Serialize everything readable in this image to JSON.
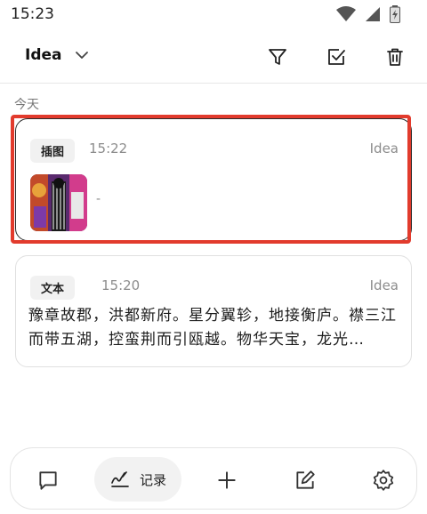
{
  "status_bar": {
    "time": "15:23"
  },
  "header": {
    "dropdown_label": "Idea"
  },
  "section": {
    "label": "今天"
  },
  "cards": [
    {
      "tag": "插图",
      "time": "15:22",
      "category": "Idea",
      "caption": "-"
    },
    {
      "tag": "文本",
      "time": "15:20",
      "category": "Idea",
      "text": "豫章故郡，洪都新府。星分翼轸，地接衡庐。襟三江而带五湖，控蛮荆而引瓯越。物华天宝，龙光…"
    }
  ],
  "bottom_nav": {
    "active_label": "记录"
  },
  "colors": {
    "highlight": "#e23b2d",
    "accent_text": "#1f1f1f",
    "muted": "#8c8c8c"
  }
}
